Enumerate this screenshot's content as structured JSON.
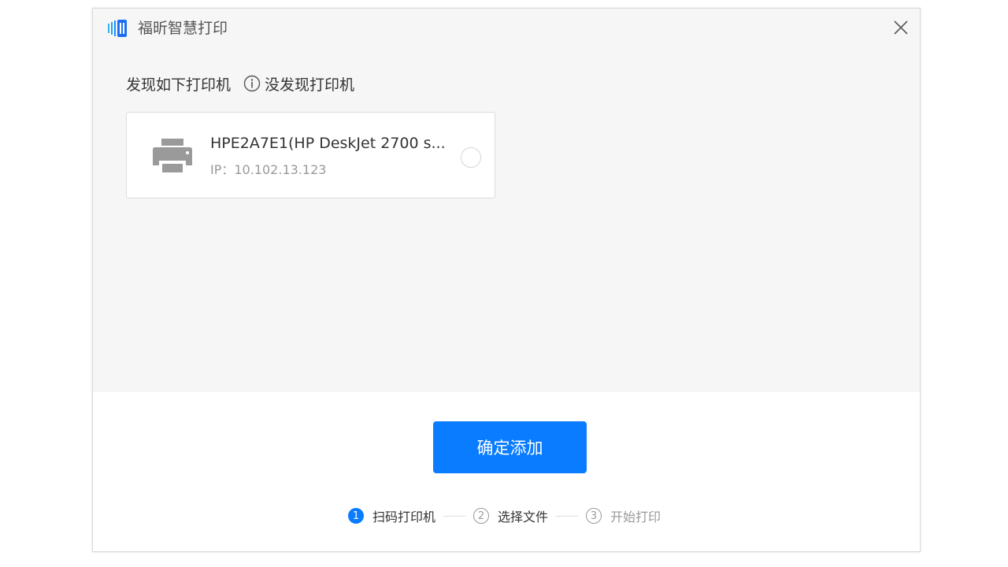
{
  "app": {
    "title": "福昕智慧打印",
    "brand_color": "#1a8cff"
  },
  "discovery": {
    "heading": "发现如下打印机",
    "not_found_label": "没发现打印机"
  },
  "printers": [
    {
      "name": "HPE2A7E1(HP DeskJet 2700 s...",
      "ip": "IP：10.102.13.123",
      "selected": false
    }
  ],
  "actions": {
    "confirm_label": "确定添加",
    "accent": "#0a7cff"
  },
  "steps": [
    {
      "num": "1",
      "label": "扫码打印机",
      "state": "active"
    },
    {
      "num": "2",
      "label": "选择文件",
      "state": "pending"
    },
    {
      "num": "3",
      "label": "开始打印",
      "state": "pending"
    }
  ],
  "icons": {
    "logo": "foxit-logo-icon",
    "close": "close-icon",
    "info": "info-icon",
    "printer": "printer-icon"
  }
}
